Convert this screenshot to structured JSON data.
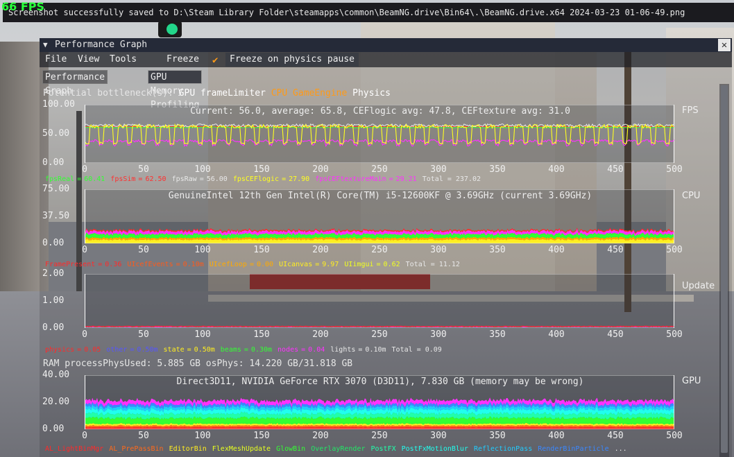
{
  "fps_counter": "66 FPS",
  "notification": "Screenshot successfully saved to D:\\Steam Library Folder\\steamapps\\common\\BeamNG.drive\\Bin64\\.\\BeamNG.drive.x64 2024-03-23 01-06-49.png",
  "window": {
    "title": "Performance Graph",
    "menu": [
      "File",
      "View",
      "Tools"
    ],
    "freeze_label": "Freeze",
    "freeze_on_pause_label": "Freeze on physics pause",
    "tabs": [
      "Performance Graph",
      "GPU Memory Profiling"
    ],
    "bottleneck": {
      "label": "Potential bottleneck(s):",
      "items": [
        {
          "text": "GPU",
          "color": "#ffffff"
        },
        {
          "text": "frameLimiter",
          "color": "#ffffff"
        },
        {
          "text": "CPU",
          "color": "#ff9a16"
        },
        {
          "text": "GameEngine",
          "color": "#ff9a16"
        },
        {
          "text": "Physics",
          "color": "#ffffff"
        }
      ]
    },
    "ram_line": "RAM  processPhysUsed: 5.885 GB  osPhys: 14.220 GB/31.818 GB"
  },
  "x_ticks": [
    "0",
    "50",
    "100",
    "150",
    "200",
    "250",
    "300",
    "350",
    "400",
    "450",
    "500"
  ],
  "chart_data": [
    {
      "type": "line",
      "side_label": "FPS",
      "title": "Current: 56.0, average: 65.8, CEFlogic avg: 47.8, CEFtexture avg: 31.0",
      "y_ticks": [
        "100.00",
        "50.00",
        "0.00"
      ],
      "ylim": [
        0,
        100
      ],
      "xlim": [
        0,
        500
      ],
      "series": [
        {
          "name": "fpsReal",
          "value": "60.41",
          "color": "#33ff33"
        },
        {
          "name": "fpsSim",
          "value": "62.50",
          "color": "#ff3030"
        },
        {
          "name": "fpsRaw",
          "value": "56.00",
          "color": "#e8e8e8"
        },
        {
          "name": "fpsCEFlogic",
          "value": "27.90",
          "color": "#ffff20"
        },
        {
          "name": "fpsCEFtextureMain",
          "value": "29.21",
          "color": "#ff30ff"
        }
      ],
      "total": "Total = 237.02"
    },
    {
      "type": "area",
      "side_label": "CPU",
      "title": "GenuineIntel 12th Gen Intel(R) Core(TM) i5-12600KF @ 3.69GHz (current 3.69GHz)",
      "y_ticks": [
        "75.00",
        "37.50",
        "0.00"
      ],
      "ylim": [
        0,
        75
      ],
      "xlim": [
        0,
        500
      ],
      "series": [
        {
          "name": "FramePresent",
          "value": "0.36",
          "color": "#ff2a2a"
        },
        {
          "name": "UIcefEvents",
          "value": "0.10m",
          "color": "#ff5a1a"
        },
        {
          "name": "UIcefLoop",
          "value": "0.00",
          "color": "#ffaa00"
        },
        {
          "name": "UIcanvas",
          "value": "9.97",
          "color": "#ffee20"
        },
        {
          "name": "UIimgui",
          "value": "0.62",
          "color": "#f0ff20"
        }
      ],
      "total": "Total = 11.12"
    },
    {
      "type": "line",
      "side_label": "Update",
      "title": "",
      "y_ticks": [
        "2.00",
        "1.00",
        "0.00"
      ],
      "ylim": [
        0,
        2
      ],
      "xlim": [
        0,
        500
      ],
      "series": [
        {
          "name": "physics",
          "value": "0.05",
          "color": "#ff2a2a"
        },
        {
          "name": "other",
          "value": "0.50m",
          "color": "#5555ff"
        },
        {
          "name": "state",
          "value": "0.50m",
          "color": "#ffee20"
        },
        {
          "name": "beams",
          "value": "0.30m",
          "color": "#33ff33"
        },
        {
          "name": "nodes",
          "value": "0.04",
          "color": "#ff30ff"
        },
        {
          "name": "lights",
          "value": "0.10m",
          "color": "#e8e8e8"
        }
      ],
      "total": "Total = 0.09"
    },
    {
      "type": "area",
      "side_label": "GPU",
      "title": "Direct3D11, NVIDIA GeForce RTX 3070 (D3D11), 7.830 GB (memory may be wrong)",
      "y_ticks": [
        "40.00",
        "20.00",
        "0.00"
      ],
      "ylim": [
        0,
        40
      ],
      "xlim": [
        0,
        500
      ],
      "series": [
        {
          "name": "AL_LightBinMgr",
          "color": "#ff2a2a"
        },
        {
          "name": "AL_PrePassBin",
          "color": "#ff6a1a"
        },
        {
          "name": "EditorBin",
          "color": "#ffee20"
        },
        {
          "name": "FlexMeshUpdate",
          "color": "#e6ff20"
        },
        {
          "name": "GlowBin",
          "color": "#33ff33"
        },
        {
          "name": "OverlayRender",
          "color": "#22e866"
        },
        {
          "name": "PostFX",
          "color": "#20ffaa"
        },
        {
          "name": "PostFxMotionBlur",
          "color": "#20ffee"
        },
        {
          "name": "ReflectionPass",
          "color": "#20ccff"
        },
        {
          "name": "RenderBinParticle",
          "color": "#3a88ff"
        }
      ],
      "legend_more": "..."
    }
  ]
}
